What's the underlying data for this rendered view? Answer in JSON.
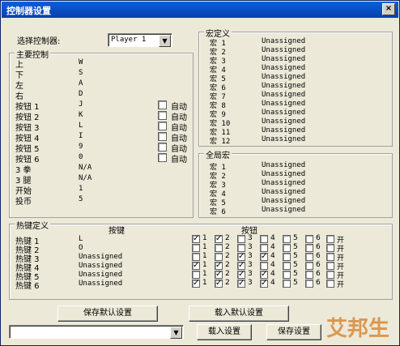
{
  "window": {
    "title": "控制器设置",
    "close_glyph": "×"
  },
  "selector": {
    "label": "选择控制器:",
    "value": "Player 1"
  },
  "main": {
    "title": "主要控制",
    "rows": [
      {
        "label": "上",
        "key": "W",
        "auto": null
      },
      {
        "label": "下",
        "key": "S",
        "auto": null
      },
      {
        "label": "左",
        "key": "A",
        "auto": null
      },
      {
        "label": "右",
        "key": "D",
        "auto": null
      },
      {
        "label": "按钮 1",
        "key": "J",
        "auto": "自动"
      },
      {
        "label": "按钮 2",
        "key": "K",
        "auto": "自动"
      },
      {
        "label": "按钮 3",
        "key": "L",
        "auto": "自动"
      },
      {
        "label": "按钮 4",
        "key": "I",
        "auto": "自动"
      },
      {
        "label": "按钮 5",
        "key": "9",
        "auto": "自动"
      },
      {
        "label": "按钮 6",
        "key": "0",
        "auto": "自动"
      },
      {
        "label": "3 拳",
        "key": "N/A",
        "auto": null
      },
      {
        "label": "3 腿",
        "key": "N/A",
        "auto": null
      },
      {
        "label": "开始",
        "key": "1",
        "auto": null
      },
      {
        "label": "投币",
        "key": "5",
        "auto": null
      }
    ]
  },
  "macro": {
    "title": "宏定义",
    "rows": [
      {
        "label": "宏 1",
        "value": "Unassigned"
      },
      {
        "label": "宏 2",
        "value": "Unassigned"
      },
      {
        "label": "宏 3",
        "value": "Unassigned"
      },
      {
        "label": "宏 4",
        "value": "Unassigned"
      },
      {
        "label": "宏 5",
        "value": "Unassigned"
      },
      {
        "label": "宏 6",
        "value": "Unassigned"
      },
      {
        "label": "宏 7",
        "value": "Unassigned"
      },
      {
        "label": "宏 8",
        "value": "Unassigned"
      },
      {
        "label": "宏 9",
        "value": "Unassigned"
      },
      {
        "label": "宏 10",
        "value": "Unassigned"
      },
      {
        "label": "宏 11",
        "value": "Unassigned"
      },
      {
        "label": "宏 12",
        "value": "Unassigned"
      }
    ]
  },
  "global_macro": {
    "title": "全局宏",
    "rows": [
      {
        "label": "宏 1",
        "value": "Unassigned"
      },
      {
        "label": "宏 2",
        "value": "Unassigned"
      },
      {
        "label": "宏 3",
        "value": "Unassigned"
      },
      {
        "label": "宏 4",
        "value": "Unassigned"
      },
      {
        "label": "宏 5",
        "value": "Unassigned"
      },
      {
        "label": "宏 6",
        "value": "Unassigned"
      }
    ]
  },
  "hotkey": {
    "title": "热键定义",
    "col_key": "按键",
    "col_btn": "按钮",
    "btn_labels": [
      "1",
      "2",
      "3",
      "4",
      "5",
      "6",
      "开"
    ],
    "rows": [
      {
        "label": "热键 1",
        "key": "L",
        "checks": [
          true,
          true,
          false,
          false,
          false,
          false,
          false
        ]
      },
      {
        "label": "热键 2",
        "key": "O",
        "checks": [
          false,
          false,
          false,
          false,
          false,
          false,
          false
        ]
      },
      {
        "label": "热键 3",
        "key": "Unassigned",
        "checks": [
          false,
          false,
          true,
          true,
          false,
          false,
          false
        ]
      },
      {
        "label": "热键 4",
        "key": "Unassigned",
        "checks": [
          true,
          true,
          true,
          false,
          false,
          false,
          false
        ]
      },
      {
        "label": "热键 5",
        "key": "Unassigned",
        "checks": [
          false,
          true,
          true,
          true,
          false,
          false,
          false
        ]
      },
      {
        "label": "热键 6",
        "key": "Unassigned",
        "checks": [
          true,
          true,
          true,
          true,
          false,
          false,
          false
        ]
      }
    ]
  },
  "buttons": {
    "save_default": "保存默认设置",
    "load_default": "载入默认设置",
    "load": "载入设置",
    "save": "保存设置"
  },
  "profile_combo": {
    "value": ""
  },
  "watermark": "艾邦生"
}
